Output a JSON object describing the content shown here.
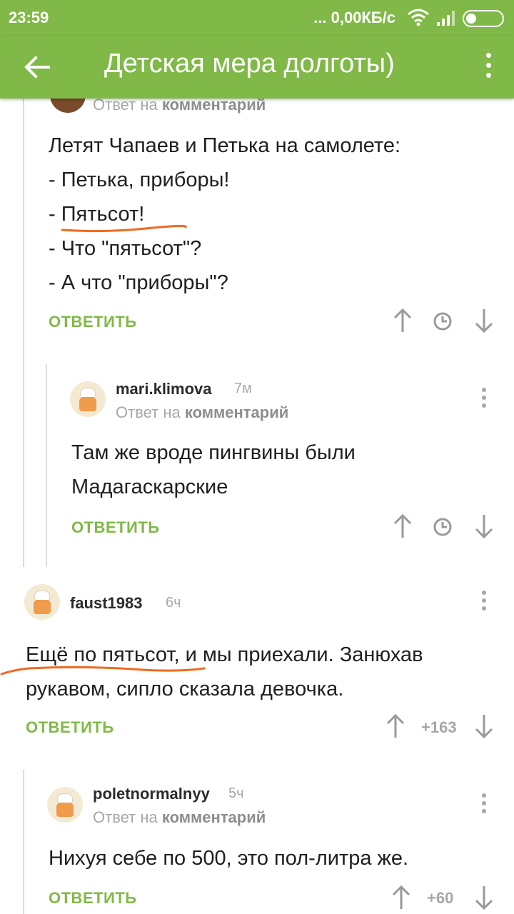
{
  "status_bar": {
    "time": "23:59",
    "network_speed": "... 0,00КБ/с",
    "icons": [
      "wifi-icon",
      "signal-icon",
      "battery-icon"
    ]
  },
  "app_bar": {
    "title": "Детская мера долготы)",
    "back_icon": "arrow-left-icon",
    "menu_icon": "more-vertical-icon"
  },
  "colors": {
    "accent": "#80b947",
    "muted": "#a7a7a7",
    "annotation": "#f06a1f"
  },
  "comments": [
    {
      "reply_to_prefix": "Ответ на",
      "reply_to_target": "комментарий",
      "lines": [
        "Летят Чапаев и Петька на самолете:",
        "- Петька, приборы!",
        "- Пятьсот!",
        "- Что \"пятьсот\"?",
        "- А что \"приборы\"?"
      ],
      "answer_label": "ОТВЕТИТЬ"
    },
    {
      "author": "mari.klimova",
      "age": "7м",
      "reply_to_prefix": "Ответ на",
      "reply_to_target": "комментарий",
      "lines": [
        "Там же вроде пингвины были",
        "Мадагаскарские"
      ],
      "answer_label": "ОТВЕТИТЬ"
    },
    {
      "author": "faust1983",
      "age": "6ч",
      "lines": [
        "Ещё по пятьсот, и мы приехали. Занюхав",
        "рукавом, сипло сказала девочка."
      ],
      "rating": "+163",
      "answer_label": "ОТВЕТИТЬ"
    },
    {
      "author": "poletnormalnyy",
      "age": "5ч",
      "reply_to_prefix": "Ответ на",
      "reply_to_target": "комментарий",
      "lines": [
        "Нихуя себе по 500, это пол-литра же."
      ],
      "rating": "+60",
      "answer_label": "ОТВЕТИТЬ"
    }
  ]
}
